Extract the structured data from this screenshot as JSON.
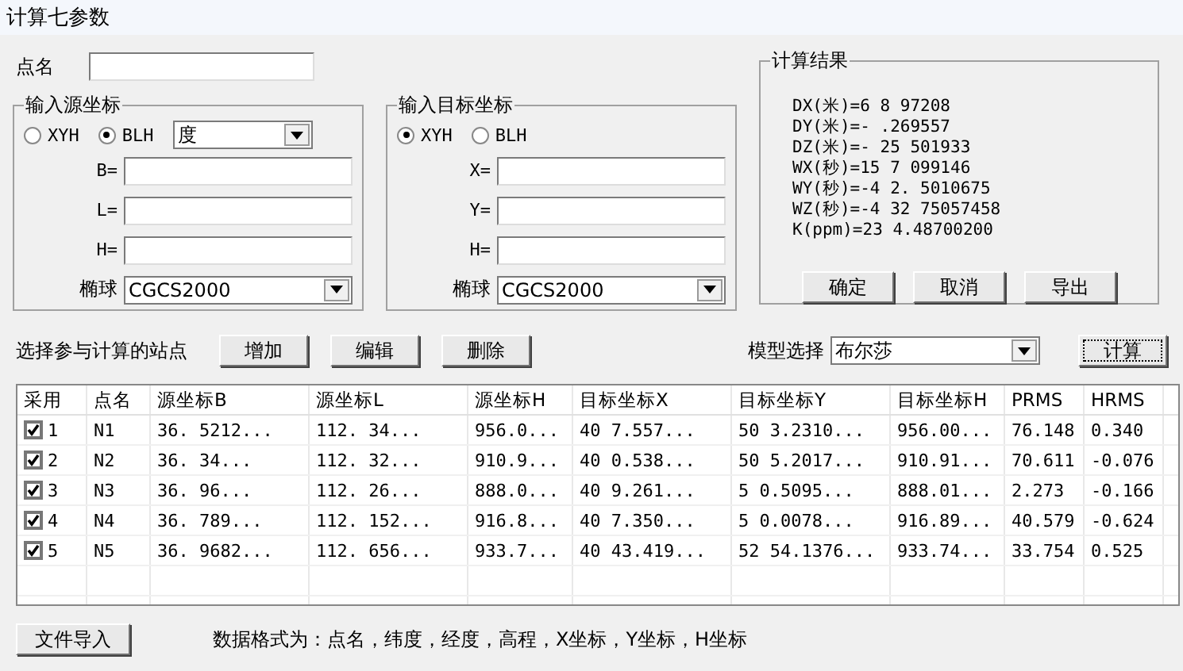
{
  "window": {
    "title": "计算七参数"
  },
  "point_name": {
    "label": "点名"
  },
  "source": {
    "title": "输入源坐标",
    "radios": [
      {
        "label": "XYH",
        "selected": false
      },
      {
        "label": "BLH",
        "selected": true
      }
    ],
    "unit": "度",
    "fields": [
      {
        "label": "B="
      },
      {
        "label": "L="
      },
      {
        "label": "H="
      }
    ],
    "ellipsoid": {
      "label": "椭球",
      "value": "CGCS2000"
    }
  },
  "target": {
    "title": "输入目标坐标",
    "radios": [
      {
        "label": "XYH",
        "selected": true
      },
      {
        "label": "BLH",
        "selected": false
      }
    ],
    "fields": [
      {
        "label": "X="
      },
      {
        "label": "Y="
      },
      {
        "label": "H="
      }
    ],
    "ellipsoid": {
      "label": "椭球",
      "value": "CGCS2000"
    }
  },
  "results": {
    "title": "计算结果",
    "lines": [
      "DX(米)=6 8 97208",
      "DY(米)=- .269557",
      "DZ(米)=- 25 501933",
      "WX(秒)=15 7 099146",
      "WY(秒)=-4 2. 5010675",
      "WZ(秒)=-4 32 75057458",
      "K(ppm)=23 4.48700200"
    ],
    "buttons": [
      "确定",
      "取消",
      "导出"
    ]
  },
  "stations": {
    "label": "选择参与计算的站点",
    "buttons": [
      "增加",
      "编辑",
      "删除"
    ]
  },
  "model": {
    "label": "模型选择",
    "value": "布尔莎"
  },
  "compute_button": "计算",
  "table": {
    "columns": [
      "采用",
      "点名",
      "源坐标B",
      "源坐标L",
      "源坐标H",
      "目标坐标X",
      "目标坐标Y",
      "目标坐标H",
      "PRMS",
      "HRMS"
    ],
    "rows": [
      {
        "checked": true,
        "cells": [
          "1",
          "N1",
          "36. 5212...",
          "112. 34...",
          "956.0...",
          "40 7.557...",
          "50 3.2310...",
          "956.00...",
          "76.148",
          "0.340"
        ]
      },
      {
        "checked": true,
        "cells": [
          "2",
          "N2",
          "36. 34...",
          "112. 32...",
          "910.9...",
          "40 0.538...",
          "50 5.2017...",
          "910.91...",
          "70.611",
          "-0.076"
        ]
      },
      {
        "checked": true,
        "cells": [
          "3",
          "N3",
          "36. 96...",
          "112. 26...",
          "888.0...",
          "40 9.261...",
          "5 0.5095...",
          "888.01...",
          "2.273",
          "-0.166"
        ]
      },
      {
        "checked": true,
        "cells": [
          "4",
          "N4",
          "36. 789...",
          "112. 152...",
          "916.8...",
          "40 7.350...",
          "5 0.0078...",
          "916.89...",
          "40.579",
          "-0.624"
        ]
      },
      {
        "checked": true,
        "cells": [
          "5",
          "N5",
          "36. 9682...",
          "112. 656...",
          "933.7...",
          "40 43.419...",
          "52 54.1376...",
          "933.74...",
          "33.754",
          "0.525"
        ]
      }
    ]
  },
  "import_button": "文件导入",
  "format_note": "数据格式为：点名，纬度，经度，高程，X坐标，Y坐标，H坐标"
}
